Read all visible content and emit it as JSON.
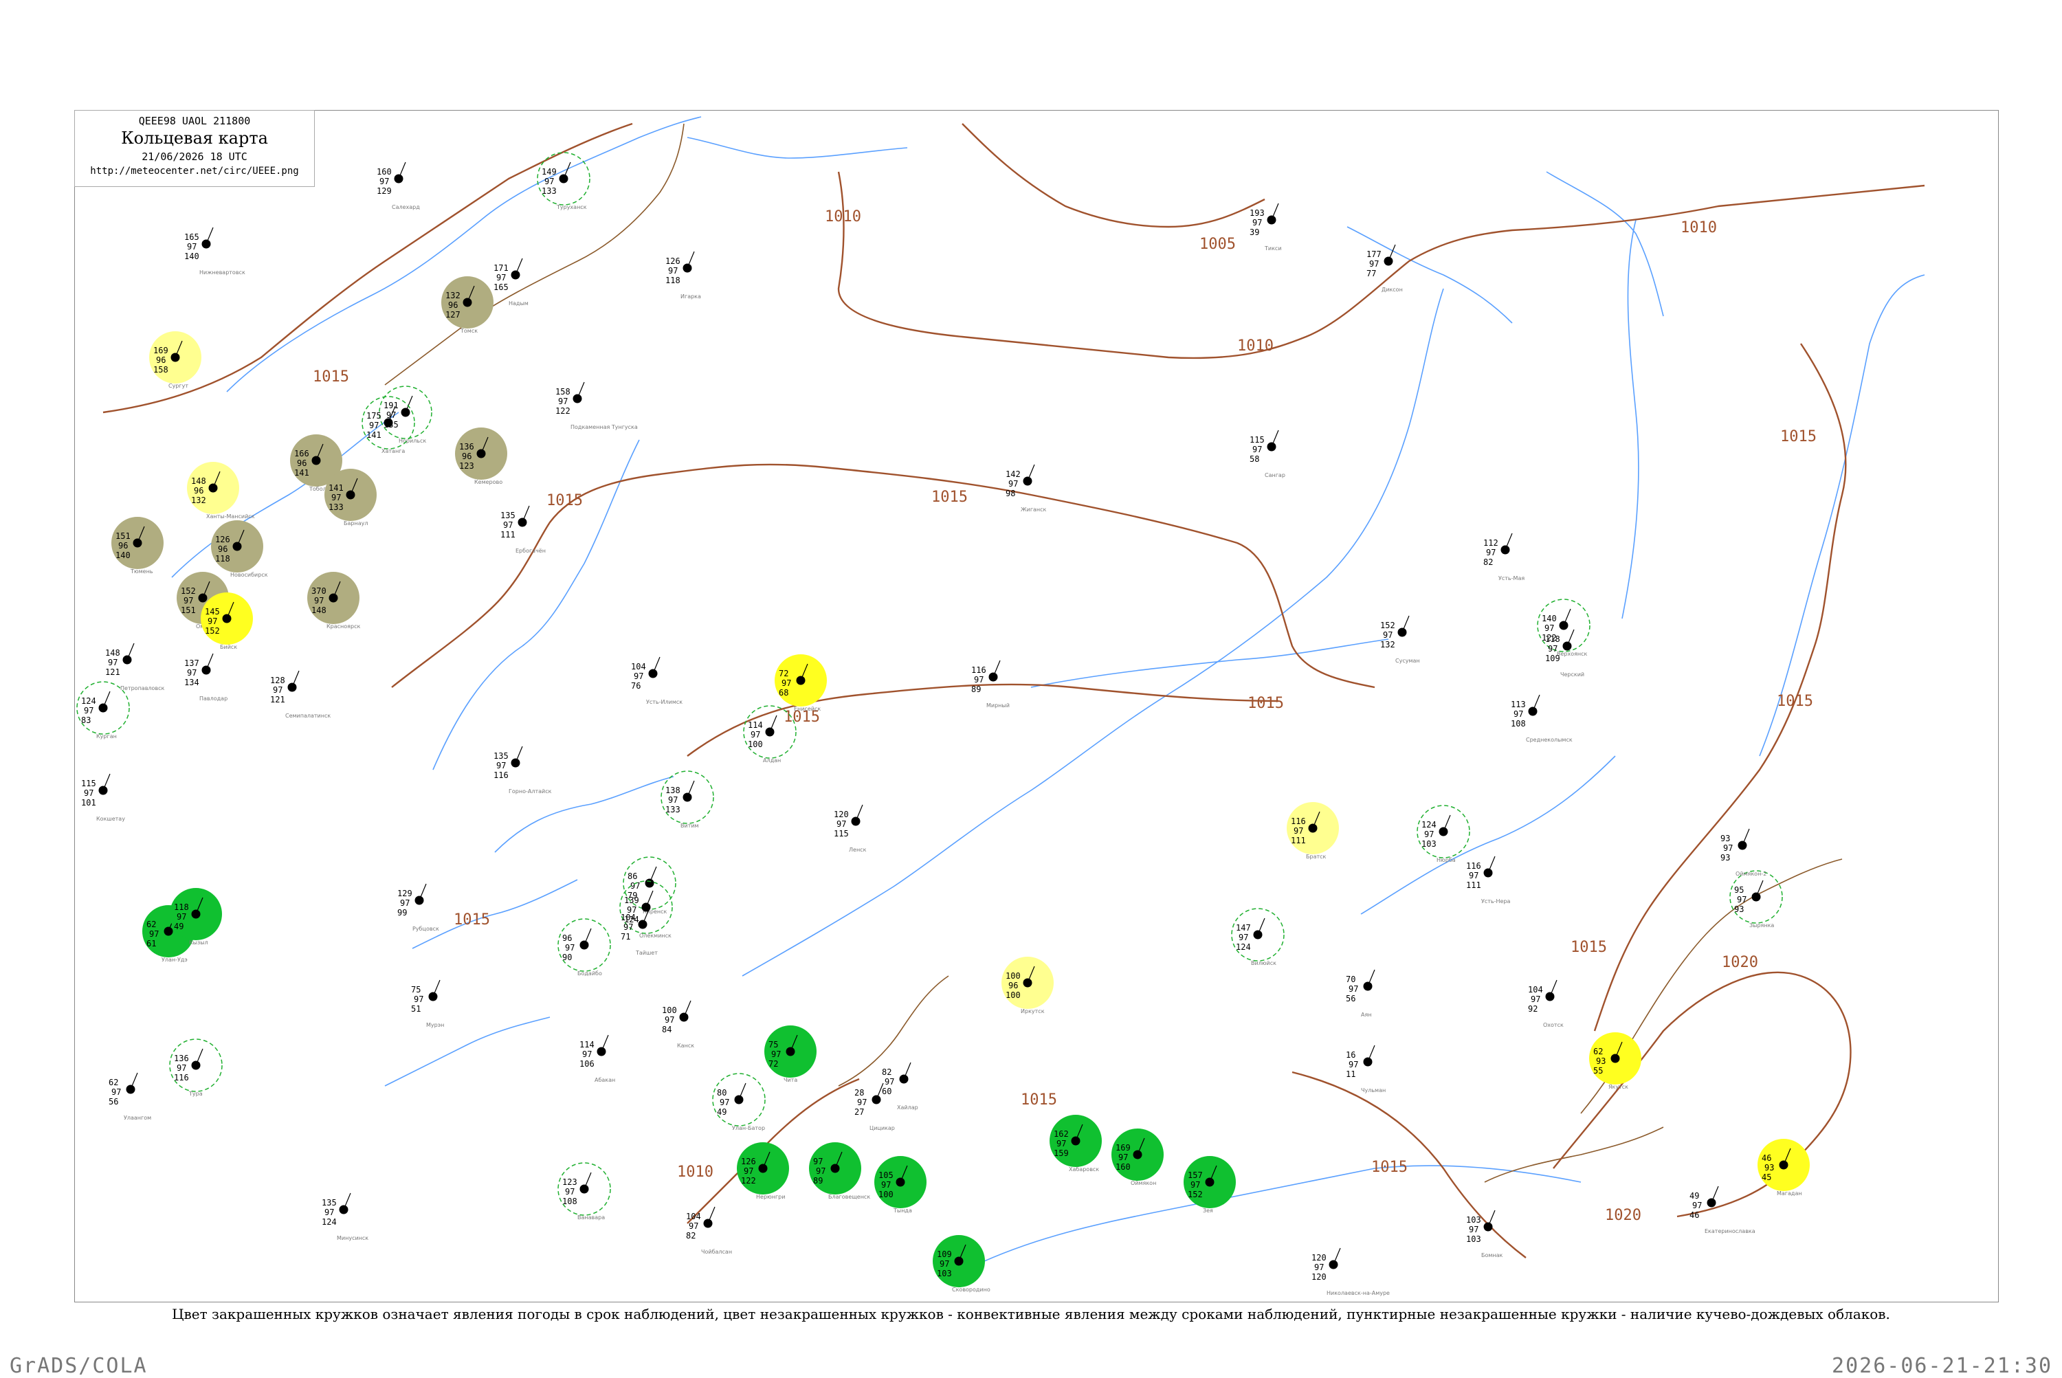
{
  "header": {
    "code": "QEEE98  UAOL  211800",
    "title": "Кольцевая карта",
    "time": "21/06/2026 18 UTC",
    "url": "http://meteocenter.net/circ/UEEE.png"
  },
  "caption": "Цвет закрашенных кружков означает явления погоды в срок наблюдений, цвет незакрашенных кружков - конвективные явления между сроками наблюдений, пунктирные незакрашенные кружки - наличие кучево-дождевых облаков.",
  "footer": {
    "left": "GrADS/COLA",
    "right": "2026-06-21-21:30"
  },
  "colors": {
    "isobar": "#a0522d",
    "river": "#5aa0ff",
    "green_fill": "#10c030",
    "olive_fill": "#b0ad80",
    "yellow_fill": "#ffff20",
    "light_yellow_fill": "#ffff90",
    "green_dashed": "#20b030"
  },
  "isobar_labels": [
    "1010",
    "1005",
    "1010",
    "1010",
    "1015",
    "1015",
    "1015",
    "1015",
    "1015",
    "1015",
    "1015",
    "1015",
    "1015",
    "1020",
    "1020",
    "1010",
    "1015",
    "1015"
  ],
  "stations": [
    {
      "name": "Нижневартовск",
      "t": "165",
      "p": "97",
      "v": "140",
      "fill": "none"
    },
    {
      "name": "Сургут",
      "t": "169",
      "p": "96",
      "v": "158",
      "fill": "lightyellow"
    },
    {
      "name": "Ханты-Мансийск",
      "t": "148",
      "p": "96",
      "v": "132",
      "fill": "lightyellow"
    },
    {
      "name": "Тюмень",
      "t": "151",
      "p": "96",
      "v": "140",
      "fill": "olive"
    },
    {
      "name": "Тобольск",
      "t": "166",
      "p": "96",
      "v": "141",
      "fill": "olive"
    },
    {
      "name": "Омск",
      "t": "152",
      "p": "97",
      "v": "151",
      "fill": "olive"
    },
    {
      "name": "Новосибирск",
      "t": "126",
      "p": "96",
      "v": "118",
      "fill": "olive"
    },
    {
      "name": "Томск",
      "t": "132",
      "p": "96",
      "v": "127",
      "fill": "olive"
    },
    {
      "name": "Кемерово",
      "t": "136",
      "p": "96",
      "v": "123",
      "fill": "olive"
    },
    {
      "name": "Барнаул",
      "t": "141",
      "p": "97",
      "v": "133",
      "fill": "olive"
    },
    {
      "name": "Бийск",
      "t": "145",
      "p": "97",
      "v": "152",
      "fill": "yellow"
    },
    {
      "name": "Красноярск",
      "t": "370",
      "p": "97",
      "v": "148",
      "fill": "olive"
    },
    {
      "name": "Енисейск",
      "t": "72",
      "p": "97",
      "v": "68",
      "fill": "yellow"
    },
    {
      "name": "Иркутск",
      "t": "100",
      "p": "96",
      "v": "100",
      "fill": "lightyellow"
    },
    {
      "name": "Братск",
      "t": "116",
      "p": "97",
      "v": "111",
      "fill": "lightyellow"
    },
    {
      "name": "Якутск",
      "t": "62",
      "p": "93",
      "v": "55",
      "fill": "yellow"
    },
    {
      "name": "Магадан",
      "t": "46",
      "p": "93",
      "v": "45",
      "fill": "yellow"
    },
    {
      "name": "Улан-Удэ",
      "t": "62",
      "p": "97",
      "v": "61",
      "fill": "green"
    },
    {
      "name": "Чита",
      "t": "75",
      "p": "97",
      "v": "72",
      "fill": "green"
    },
    {
      "name": "Благовещенск",
      "t": "97",
      "p": "97",
      "v": "89",
      "fill": "green"
    },
    {
      "name": "Хабаровск",
      "t": "162",
      "p": "97",
      "v": "159",
      "fill": "green"
    },
    {
      "name": "Оймякон",
      "t": "169",
      "p": "97",
      "v": "160",
      "fill": "green"
    },
    {
      "name": "Кызыл",
      "t": "118",
      "p": "97",
      "v": "49",
      "fill": "green"
    },
    {
      "name": "Нерюнгри",
      "t": "126",
      "p": "97",
      "v": "122",
      "fill": "green"
    },
    {
      "name": "Тында",
      "t": "105",
      "p": "97",
      "v": "100",
      "fill": "green"
    },
    {
      "name": "Сковородино",
      "t": "109",
      "p": "97",
      "v": "103",
      "fill": "green"
    },
    {
      "name": "Зея",
      "t": "157",
      "p": "97",
      "v": "152",
      "fill": "green"
    },
    {
      "name": "Алдан",
      "t": "114",
      "p": "97",
      "v": "100",
      "fill": "dashed"
    },
    {
      "name": "Витим",
      "t": "138",
      "p": "97",
      "v": "133",
      "fill": "dashed"
    },
    {
      "name": "Киренск",
      "t": "86",
      "p": "97",
      "v": "79",
      "fill": "dashed"
    },
    {
      "name": "Бодайбо",
      "t": "96",
      "p": "97",
      "v": "90",
      "fill": "dashed"
    },
    {
      "name": "Олёкминск",
      "t": "139",
      "p": "97",
      "v": "124",
      "fill": "dashed"
    },
    {
      "name": "Вилюйск",
      "t": "147",
      "p": "97",
      "v": "124",
      "fill": "dashed"
    },
    {
      "name": "Верхоянск",
      "t": "140",
      "p": "97",
      "v": "122",
      "fill": "dashed"
    },
    {
      "name": "Зырянка",
      "t": "95",
      "p": "97",
      "v": "93",
      "fill": "dashed"
    },
    {
      "name": "Нюрба",
      "t": "124",
      "p": "97",
      "v": "103",
      "fill": "dashed"
    },
    {
      "name": "Тура",
      "t": "136",
      "p": "97",
      "v": "116",
      "fill": "dashed"
    },
    {
      "name": "Ванавара",
      "t": "123",
      "p": "97",
      "v": "108",
      "fill": "dashed"
    },
    {
      "name": "Туруханск",
      "t": "149",
      "p": "97",
      "v": "133",
      "fill": "dashed"
    },
    {
      "name": "Норильск",
      "t": "191",
      "p": "97",
      "v": "135",
      "fill": "dashed"
    },
    {
      "name": "Хатанга",
      "t": "175",
      "p": "97",
      "v": "141",
      "fill": "dashed"
    },
    {
      "name": "Диксон",
      "t": "177",
      "p": "97",
      "v": "77",
      "fill": "none"
    },
    {
      "name": "Тикси",
      "t": "193",
      "p": "97",
      "v": "39",
      "fill": "none"
    },
    {
      "name": "Салехард",
      "t": "160",
      "p": "97",
      "v": "129",
      "fill": "none"
    },
    {
      "name": "Надым",
      "t": "171",
      "p": "97",
      "v": "165",
      "fill": "none"
    },
    {
      "name": "Игарка",
      "t": "126",
      "p": "97",
      "v": "118",
      "fill": "none"
    },
    {
      "name": "Подкаменная Тунгуска",
      "t": "158",
      "p": "97",
      "v": "122",
      "fill": "none"
    },
    {
      "name": "Ербогачён",
      "t": "135",
      "p": "97",
      "v": "111",
      "fill": "none"
    },
    {
      "name": "Усть-Илимск",
      "t": "104",
      "p": "97",
      "v": "76",
      "fill": "none"
    },
    {
      "name": "Жиганск",
      "t": "142",
      "p": "97",
      "v": "98",
      "fill": "none"
    },
    {
      "name": "Сангар",
      "t": "115",
      "p": "97",
      "v": "58",
      "fill": "none"
    },
    {
      "name": "Усть-Мая",
      "t": "112",
      "p": "97",
      "v": "82",
      "fill": "none"
    },
    {
      "name": "Охотск",
      "t": "104",
      "p": "97",
      "v": "92",
      "fill": "none"
    },
    {
      "name": "Аян",
      "t": "70",
      "p": "97",
      "v": "56",
      "fill": "none"
    },
    {
      "name": "Николаевск-на-Амуре",
      "t": "120",
      "p": "97",
      "v": "120",
      "fill": "none"
    },
    {
      "name": "Бомнак",
      "t": "103",
      "p": "97",
      "v": "103",
      "fill": "none"
    },
    {
      "name": "Екатеринославка",
      "t": "49",
      "p": "97",
      "v": "46",
      "fill": "none"
    },
    {
      "name": "Сусуман",
      "t": "152",
      "p": "97",
      "v": "132",
      "fill": "none"
    },
    {
      "name": "Среднеколымск",
      "t": "113",
      "p": "97",
      "v": "108",
      "fill": "none"
    },
    {
      "name": "Черский",
      "t": "118",
      "p": "97",
      "v": "109",
      "fill": "none"
    },
    {
      "name": "Усть-Нера",
      "t": "116",
      "p": "97",
      "v": "111",
      "fill": "none"
    },
    {
      "name": "Оймякон-2",
      "t": "93",
      "p": "97",
      "v": "93",
      "fill": "none"
    },
    {
      "name": "Чульман",
      "t": "16",
      "p": "97",
      "v": "11",
      "fill": "none"
    },
    {
      "name": "Ленск",
      "t": "120",
      "p": "97",
      "v": "115",
      "fill": "none"
    },
    {
      "name": "Мирный",
      "t": "116",
      "p": "97",
      "v": "89",
      "fill": "none"
    },
    {
      "name": "Тайшет",
      "t": "104",
      "p": "97",
      "v": "71",
      "fill": "none"
    },
    {
      "name": "Канск",
      "t": "100",
      "p": "97",
      "v": "84",
      "fill": "none"
    },
    {
      "name": "Абакан",
      "t": "114",
      "p": "97",
      "v": "106",
      "fill": "none"
    },
    {
      "name": "Минусинск",
      "t": "135",
      "p": "97",
      "v": "124",
      "fill": "none"
    },
    {
      "name": "Горно-Алтайск",
      "t": "135",
      "p": "97",
      "v": "116",
      "fill": "none"
    },
    {
      "name": "Рубцовск",
      "t": "129",
      "p": "97",
      "v": "99",
      "fill": "none"
    },
    {
      "name": "Семипалатинск",
      "t": "128",
      "p": "97",
      "v": "121",
      "fill": "none"
    },
    {
      "name": "Павлодар",
      "t": "137",
      "p": "97",
      "v": "134",
      "fill": "none"
    },
    {
      "name": "Петропавловск",
      "t": "148",
      "p": "97",
      "v": "121",
      "fill": "none"
    },
    {
      "name": "Курган",
      "t": "124",
      "p": "97",
      "v": "83",
      "fill": "dashed"
    },
    {
      "name": "Кокшетау",
      "t": "115",
      "p": "97",
      "v": "101",
      "fill": "none"
    },
    {
      "name": "Улаангом",
      "t": "62",
      "p": "97",
      "v": "56",
      "fill": "none"
    },
    {
      "name": "Мурэн",
      "t": "75",
      "p": "97",
      "v": "51",
      "fill": "none"
    },
    {
      "name": "Улан-Батор",
      "t": "80",
      "p": "97",
      "v": "49",
      "fill": "dashed"
    },
    {
      "name": "Чойбалсан",
      "t": "104",
      "p": "97",
      "v": "82",
      "fill": "none"
    },
    {
      "name": "Хайлар",
      "t": "82",
      "p": "97",
      "v": "60",
      "fill": "none"
    },
    {
      "name": "Цицикар",
      "t": "28",
      "p": "97",
      "v": "27",
      "fill": "none"
    }
  ]
}
